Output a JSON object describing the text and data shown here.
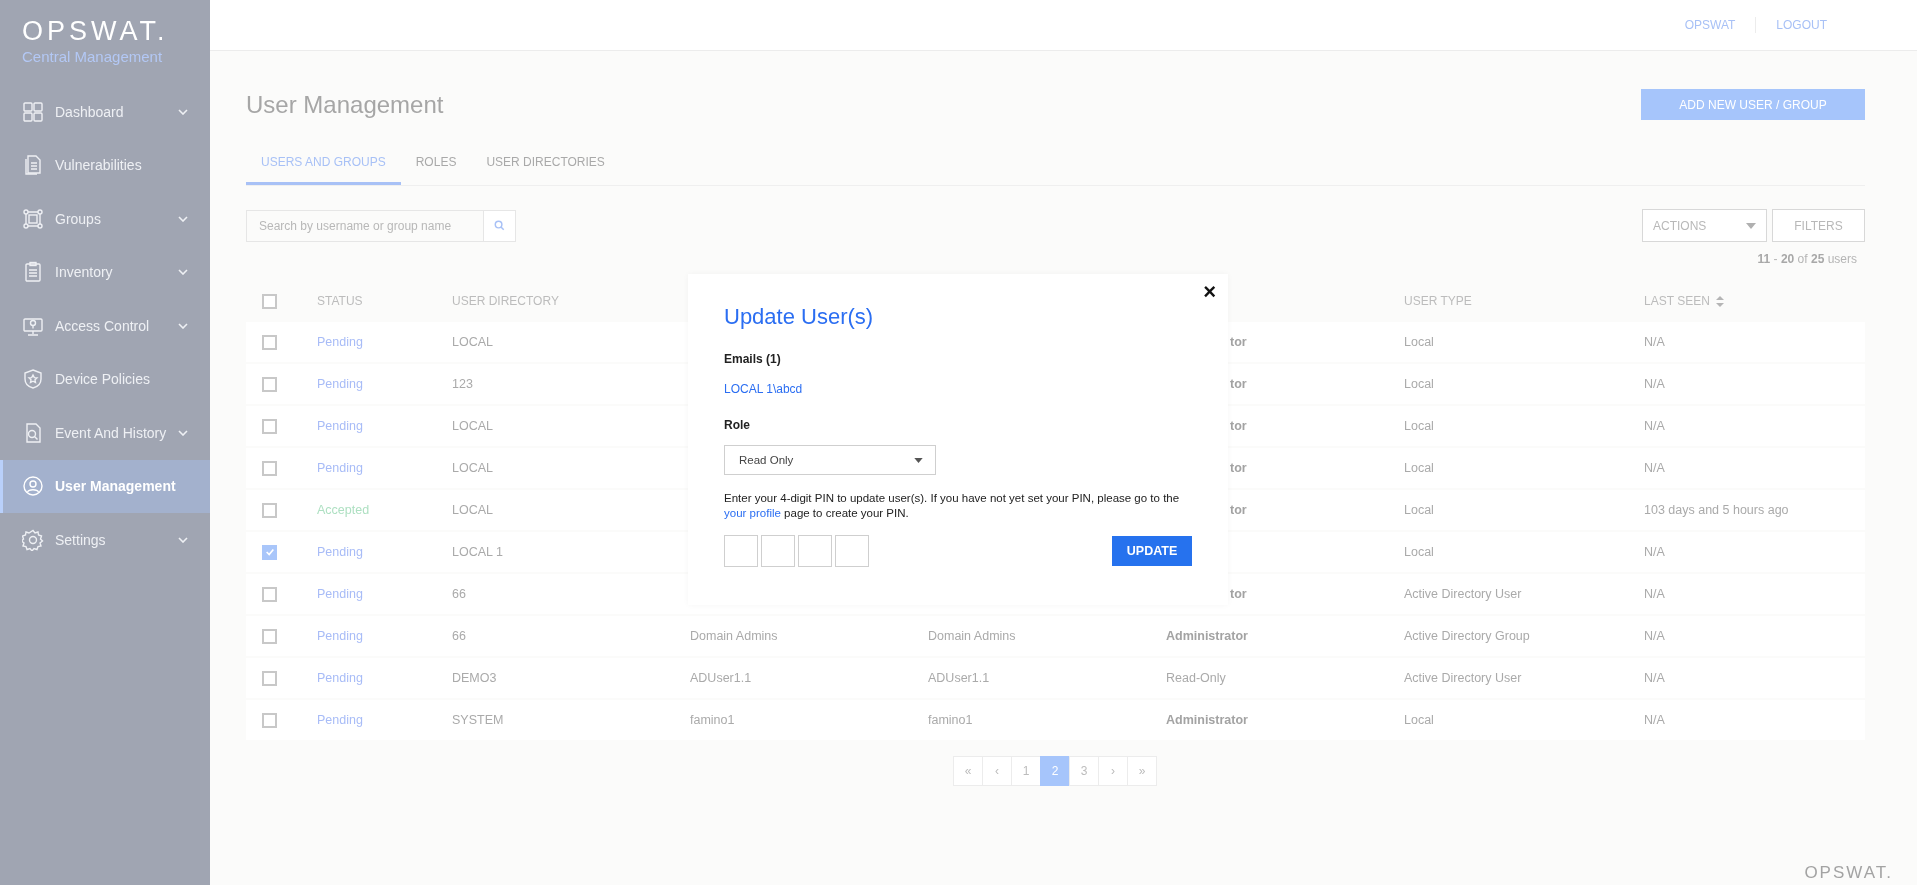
{
  "brand": {
    "logo": "OPSWAT.",
    "subtitle": "Central Management"
  },
  "sidebar": {
    "items": [
      {
        "label": "Dashboard",
        "expandable": true,
        "selected": false
      },
      {
        "label": "Vulnerabilities",
        "expandable": false,
        "selected": false
      },
      {
        "label": "Groups",
        "expandable": true,
        "selected": false
      },
      {
        "label": "Inventory",
        "expandable": true,
        "selected": false
      },
      {
        "label": "Access Control",
        "expandable": true,
        "selected": false
      },
      {
        "label": "Device Policies",
        "expandable": false,
        "selected": false
      },
      {
        "label": "Event And History",
        "expandable": true,
        "selected": false
      },
      {
        "label": "User Management",
        "expandable": false,
        "selected": true
      },
      {
        "label": "Settings",
        "expandable": true,
        "selected": false
      }
    ]
  },
  "top_bar": {
    "links": [
      "OPSWAT",
      "LOGOUT"
    ]
  },
  "page": {
    "title": "User Management",
    "add_button": "ADD NEW USER / GROUP"
  },
  "tabs": [
    {
      "label": "USERS AND GROUPS",
      "selected": true
    },
    {
      "label": "ROLES",
      "selected": false
    },
    {
      "label": "USER DIRECTORIES",
      "selected": false
    }
  ],
  "search": {
    "placeholder": "Search by username or group name"
  },
  "actions": {
    "label": "ACTIONS"
  },
  "filters": {
    "label": "FILTERS"
  },
  "count": "**11** - **20** of **25** users",
  "table": {
    "columns": [
      "STATUS",
      "USER DIRECTORY",
      "USER TYPE",
      "LAST SEEN"
    ],
    "header_checked": false,
    "rows": [
      {
        "checked": false,
        "status": {
          "text": "Pending",
          "color": "#a8bcf7"
        },
        "user_directory": "LOCAL",
        "role": {
          "text": "tor",
          "bold": true
        },
        "user_type": "Local",
        "last_seen": "N/A"
      },
      {
        "checked": false,
        "status": {
          "text": "Pending",
          "color": "#a8bcf7"
        },
        "user_directory": "123",
        "role": {
          "text": "tor",
          "bold": true
        },
        "user_type": "Local",
        "last_seen": "N/A"
      },
      {
        "checked": false,
        "status": {
          "text": "Pending",
          "color": "#a8bcf7"
        },
        "user_directory": "LOCAL",
        "role": {
          "text": "tor",
          "bold": true
        },
        "user_type": "Local",
        "last_seen": "N/A"
      },
      {
        "checked": false,
        "status": {
          "text": "Pending",
          "color": "#a8bcf7"
        },
        "user_directory": "LOCAL",
        "role": {
          "text": "tor",
          "bold": true
        },
        "user_type": "Local",
        "last_seen": "N/A"
      },
      {
        "checked": false,
        "status": {
          "text": "Accepted",
          "color": "#aee0c2"
        },
        "user_directory": "LOCAL",
        "role": {
          "text": "tor",
          "bold": true
        },
        "user_type": "Local",
        "last_seen": "103 days and 5 hours ago"
      },
      {
        "checked": true,
        "status": {
          "text": "Pending",
          "color": "#a8bcf7"
        },
        "user_directory": "LOCAL 1",
        "user_type": "Local",
        "last_seen": "N/A"
      },
      {
        "checked": false,
        "status": {
          "text": "Pending",
          "color": "#a8bcf7"
        },
        "user_directory": "66",
        "role": {
          "text": "tor",
          "bold": true
        },
        "user_type": "Active Directory User",
        "last_seen": "N/A"
      },
      {
        "checked": false,
        "status": {
          "text": "Pending",
          "color": "#a8bcf7"
        },
        "user_directory": "66",
        "column_3": "Domain Admins",
        "column_4": "Domain Admins",
        "role": {
          "text": "Administrator",
          "bold": true
        },
        "user_type": "Active Directory Group",
        "last_seen": "N/A"
      },
      {
        "checked": false,
        "status": {
          "text": "Pending",
          "color": "#a8bcf7"
        },
        "user_directory": "DEMO3",
        "column_3": "ADUser1.1",
        "column_4": "ADUser1.1",
        "role": {
          "text": "Read-Only",
          "bold": false
        },
        "user_type": "Active Directory User",
        "last_seen": "N/A"
      },
      {
        "checked": false,
        "status": {
          "text": "Pending",
          "color": "#a8bcf7"
        },
        "user_directory": "SYSTEM",
        "column_3": "famino1",
        "column_4": "famino1",
        "role": {
          "text": "Administrator",
          "bold": true
        },
        "user_type": "Local",
        "last_seen": "N/A"
      }
    ]
  },
  "pagination": [
    {
      "label": "«",
      "selected": false
    },
    {
      "label": "‹",
      "selected": false
    },
    {
      "label": "1",
      "selected": false
    },
    {
      "label": "2",
      "selected": true
    },
    {
      "label": "3",
      "selected": false
    },
    {
      "label": "›",
      "selected": false
    },
    {
      "label": "»",
      "selected": false
    }
  ],
  "footer_logo": "OPSWAT.",
  "modal": {
    "close": "×",
    "title": "Update User(s)",
    "emails_label": "Emails (1)",
    "email": "LOCAL 1\\abcd",
    "role_label": "Role",
    "role_value": "Read Only",
    "message_before": "Enter your 4-digit PIN to update user(s). If you have not yet set your PIN, please go to the",
    "message_link": "your profile",
    "message_after": "page to create your PIN.",
    "button": "UPDATE"
  }
}
